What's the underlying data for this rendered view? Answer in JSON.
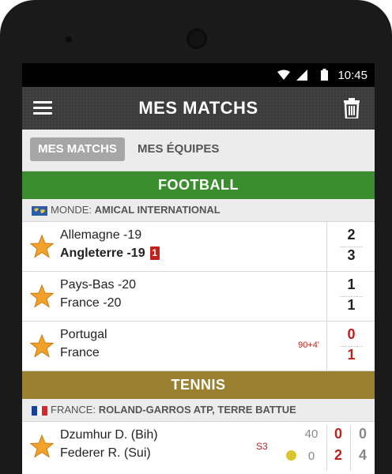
{
  "status": {
    "time": "10:45"
  },
  "appbar": {
    "title": "MES MATCHS"
  },
  "tabs": {
    "active": "MES MATCHS",
    "other": "MES ÉQUIPES"
  },
  "football": {
    "header": "FOOTBALL",
    "competition": {
      "country": "MONDE:",
      "name": "AMICAL INTERNATIONAL"
    },
    "matches": [
      {
        "home": "Allemagne -19",
        "away": "Angleterre -19",
        "away_cards": "1",
        "home_score": "2",
        "away_score": "3"
      },
      {
        "home": "Pays-Bas -20",
        "away": "France -20",
        "home_score": "1",
        "away_score": "1"
      },
      {
        "home": "Portugal",
        "away": "France",
        "minute": "90+4'",
        "home_score": "0",
        "away_score": "1"
      }
    ]
  },
  "tennis": {
    "header": "TENNIS",
    "competition": {
      "country": "FRANCE:",
      "name": "ROLAND-GARROS ATP, TERRE BATTUE"
    },
    "matches": [
      {
        "p1": "Dzumhur D. (Bih)",
        "p2": "Federer R. (Sui)",
        "set": "S3",
        "p1_points": "40",
        "p2_points": "0",
        "p1_game": "0",
        "p2_game": "2",
        "p1_sets": "0",
        "p2_sets": "4"
      }
    ]
  },
  "colors": {
    "football": "#3b8e2d",
    "tennis": "#9a8132",
    "accent_red": "#c0211d",
    "appbar": "#3b3b3b"
  }
}
